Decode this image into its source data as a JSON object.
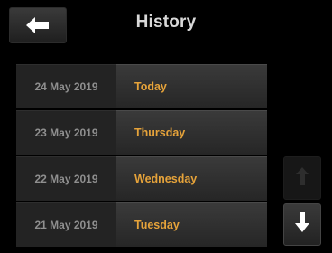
{
  "header": {
    "title": "History",
    "back_icon": "arrow-left-icon"
  },
  "history": {
    "rows": [
      {
        "date": "24 May 2019",
        "day": "Today"
      },
      {
        "date": "23 May 2019",
        "day": "Thursday"
      },
      {
        "date": "22 May 2019",
        "day": "Wednesday"
      },
      {
        "date": "21 May 2019",
        "day": "Tuesday"
      }
    ]
  },
  "scroll": {
    "up_icon": "arrow-up-icon",
    "up_enabled": false,
    "down_icon": "arrow-down-icon",
    "down_enabled": true
  },
  "colors": {
    "background": "#000000",
    "title": "#d9d9d9",
    "date_text": "#8f8f8f",
    "day_text": "#e6a33a",
    "icon_active": "#ffffff",
    "icon_disabled": "#2e2e2e"
  }
}
